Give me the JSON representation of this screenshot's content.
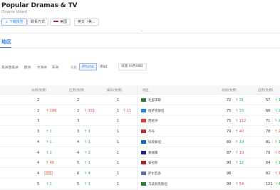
{
  "header": {
    "title": "Popular Dramas & TV",
    "subtitle": "(Drama Video)",
    "buttons": {
      "download": "↓ 下载报告",
      "contact": "联系方式",
      "country": "美国",
      "language": "英文（美..."
    }
  },
  "section": {
    "title": "地区"
  },
  "filters": {
    "regions": [
      "美洲",
      "欧美洲",
      "欧洲",
      "大洋洲",
      "非洲"
    ],
    "device_label": "设备",
    "devices": [
      "iPhone",
      "iPad"
    ],
    "active_device": "iPhone",
    "date_label": "日期",
    "date_value": "04月08日"
  },
  "table": {
    "left_headers": [
      "总榜(免费)",
      "应用(免费)",
      "娱乐(免费)"
    ],
    "right_headers": [
      "地区",
      "总榜(免费)",
      "应用(免费)"
    ],
    "rows": [
      {
        "l1": "2",
        "l1d": "",
        "l1b": "",
        "l2": "2",
        "l2d": "",
        "l3": "1",
        "l3d": "",
        "cflag": "#2e7d32",
        "country": "毛里求斯",
        "r1": "72",
        "r1d": "↑ 31",
        "r1c": "up",
        "r2": "57",
        "r2d": "↑ 19",
        "r2c": "up"
      },
      {
        "l1": "2",
        "l1d": "↑ 189",
        "l1b": "",
        "l2": "2",
        "l2d": "↑ 151",
        "l3": "1",
        "l3d": "↑ 11",
        "cflag": "#1e88e5",
        "country": "哈萨克斯坦",
        "r1": "75",
        "r1d": "↑ 33",
        "r1c": "up",
        "r2": "66",
        "r2d": "↑ 23",
        "r2c": "up"
      },
      {
        "l1": "3",
        "l1d": "",
        "l1b": "",
        "l2": "3",
        "l2d": "",
        "l3": "1",
        "l3d": "",
        "cflag": "#e53935",
        "country": "西班牙",
        "r1": "75",
        "r1d": "↑ 112",
        "r1c": "down",
        "r2": "71",
        "r2d": "↑ 20",
        "r2c": "up"
      },
      {
        "l1": "3",
        "l1d": "↑ 1",
        "l1b": "",
        "l2": "3",
        "l2d": "↑ 1",
        "l3": "1",
        "l3d": "",
        "cflag": "#c62828",
        "country": "不丹",
        "r1": "79",
        "r1d": "↑ 40",
        "r1c": "down",
        "r2": "78",
        "r2d": "↑ 24",
        "r2c": "down"
      },
      {
        "l1": "4",
        "l1d": "↑ 1",
        "l1b": "",
        "l2": "4",
        "l2d": "↑ 1",
        "l3": "1",
        "l3d": "",
        "cflag": "#1565c0",
        "country": "埃及斯坦",
        "r1": "83",
        "r1d": "↑ 19",
        "r1c": "up",
        "r2": "81",
        "r2d": "↑ 19",
        "r2c": "up"
      },
      {
        "l1": "4",
        "l1d": "↑ 2",
        "l1b": "",
        "l2": "4",
        "l2d": "↑ 2",
        "l3": "1",
        "l3d": "",
        "cflag": "#1a237e",
        "country": "柬埔寨",
        "r1": "87",
        "r1d": "↑ 10",
        "r1c": "down",
        "r2": "70",
        "r2d": "↑ 6",
        "r2c": "down"
      },
      {
        "l1": "4",
        "l1d": "↑ 46",
        "l1b": "",
        "l2": "5",
        "l2d": "↑ 1",
        "l3": "1",
        "l3d": "",
        "cflag": "#b71c1c",
        "country": "安拉斯",
        "r1": "90",
        "r1d": "↑ 12",
        "r1c": "up",
        "r2": "64",
        "r2d": "↑ 12",
        "r2c": "up"
      },
      {
        "l1": "4",
        "l1d": "",
        "l1b": "NEW",
        "l2": "6",
        "l2d": "↑ 4",
        "l3": "1",
        "l3d": "",
        "cflag": "#5c6bc0",
        "country": "萨尔瓦多",
        "r1": "98",
        "r1d": "",
        "r1c": "up",
        "r2": "82",
        "r2d": "↑ 1",
        "r2c": "down"
      },
      {
        "l1": "5",
        "l1d": "↑ 1",
        "l1b": "",
        "l2": "5",
        "l2d": "↑ 1",
        "l3": "1",
        "l3d": "",
        "cflag": "#2e7d32",
        "country": "乌兹别克斯坦",
        "r1": "99",
        "r1d": "↑ 54",
        "r1c": "down",
        "r2": "121",
        "r2d": "↑ 46",
        "r2c": "up"
      }
    ]
  }
}
